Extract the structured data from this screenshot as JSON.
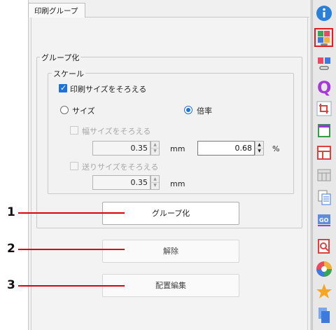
{
  "tab": {
    "label": "印刷グループ"
  },
  "grouping": {
    "legend": "グループ化",
    "scale": {
      "legend": "スケール",
      "match_print_size": {
        "label": "印刷サイズをそろえる",
        "checked": true
      },
      "size_option": {
        "label": "サイズ",
        "selected": false
      },
      "ratio_option": {
        "label": "倍率",
        "selected": true
      },
      "match_width": {
        "label": "幅サイズをそろえる",
        "checked": false,
        "enabled": false
      },
      "width_value": "0.35",
      "width_unit": "mm",
      "ratio_value": "0.68",
      "ratio_unit": "%",
      "match_feed": {
        "label": "送りサイズをそろえる",
        "checked": false,
        "enabled": false
      },
      "feed_value": "0.35",
      "feed_unit": "mm"
    },
    "group_button": "グループ化"
  },
  "release_button": "解除",
  "layout_edit_button": "配置編集",
  "callouts": [
    "1",
    "2",
    "3"
  ],
  "colors": {
    "accent": "#1f72d6",
    "callout": "#d9000a",
    "selection": "#e02020"
  },
  "toolbar": [
    {
      "icon": "info-icon",
      "selected": false
    },
    {
      "icon": "print-group-icon",
      "selected": true
    },
    {
      "icon": "link-group-icon",
      "selected": false
    },
    {
      "icon": "quality-icon",
      "selected": false
    },
    {
      "icon": "crop-icon",
      "selected": false
    },
    {
      "icon": "top-margin-icon",
      "selected": false
    },
    {
      "icon": "layout-icon",
      "selected": false
    },
    {
      "icon": "table-icon",
      "selected": false
    },
    {
      "icon": "copy-icon",
      "selected": false
    },
    {
      "icon": "go-icon",
      "selected": false
    },
    {
      "icon": "document-search-icon",
      "selected": false
    },
    {
      "icon": "color-wheel-icon",
      "selected": false
    },
    {
      "icon": "star-icon",
      "selected": false
    },
    {
      "icon": "pages-icon",
      "selected": false
    }
  ]
}
